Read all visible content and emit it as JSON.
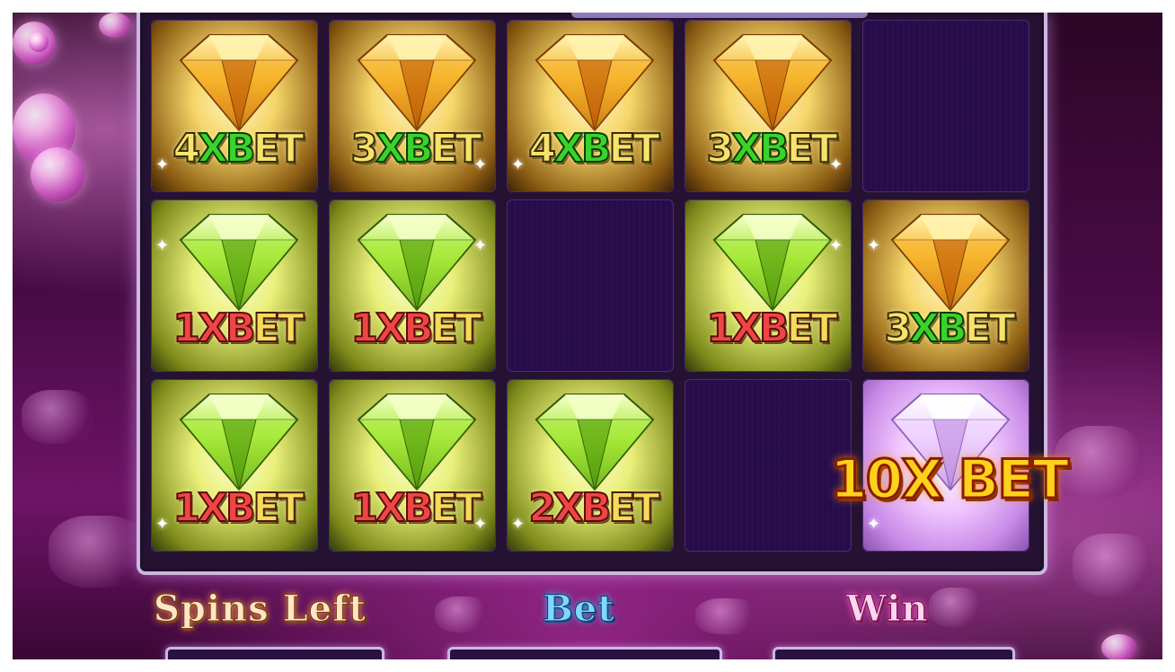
{
  "grid": {
    "rows": [
      [
        {
          "kind": "gold",
          "num": "4",
          "x": "X",
          "b": "B",
          "rest": "ET"
        },
        {
          "kind": "gold",
          "num": "3",
          "x": "X",
          "b": "B",
          "rest": "ET"
        },
        {
          "kind": "gold",
          "num": "4",
          "x": "X",
          "b": "B",
          "rest": "ET"
        },
        {
          "kind": "gold",
          "num": "3",
          "x": "X",
          "b": "B",
          "rest": "ET"
        },
        {
          "kind": "empty"
        }
      ],
      [
        {
          "kind": "green",
          "num": "1",
          "x": "X",
          "b": "B",
          "rest": "ET"
        },
        {
          "kind": "green",
          "num": "1",
          "x": "X",
          "b": "B",
          "rest": "ET"
        },
        {
          "kind": "empty"
        },
        {
          "kind": "green",
          "num": "1",
          "x": "X",
          "b": "B",
          "rest": "ET"
        },
        {
          "kind": "gold",
          "num": "3",
          "x": "X",
          "b": "B",
          "rest": "ET"
        }
      ],
      [
        {
          "kind": "green",
          "num": "1",
          "x": "X",
          "b": "B",
          "rest": "ET"
        },
        {
          "kind": "green",
          "num": "1",
          "x": "X",
          "b": "B",
          "rest": "ET"
        },
        {
          "kind": "green",
          "num": "2",
          "x": "X",
          "b": "B",
          "rest": "ET"
        },
        {
          "kind": "empty"
        },
        {
          "kind": "purple",
          "big": "10X BET"
        }
      ]
    ]
  },
  "labels": {
    "spins_left": "Spins Left",
    "bet": "Bet",
    "win": "Win"
  },
  "colors": {
    "gold_gem": "#f5a623",
    "green_gem": "#9be33a",
    "purple_gem": "#e6c6ff",
    "frame": "#cdb7e0",
    "spins_left": "#ffe6c8",
    "bet": "#7fd8ff",
    "win": "#ffd6f0"
  }
}
